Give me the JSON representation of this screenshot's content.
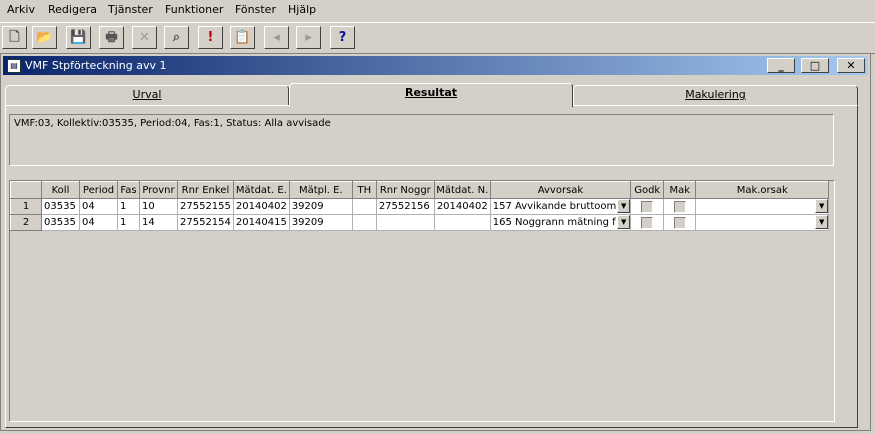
{
  "menu": [
    "Arkiv",
    "Redigera",
    "Tjänster",
    "Funktioner",
    "Fönster",
    "Hjälp"
  ],
  "toolbar": [
    {
      "icon": "new-document-icon",
      "glyph": "🗋"
    },
    {
      "icon": "open-folder-icon",
      "glyph": "📂"
    },
    {
      "icon": "save-icon",
      "glyph": "💾"
    },
    {
      "icon": "print-icon",
      "glyph": "🖶"
    },
    {
      "icon": "delete-x-icon",
      "glyph": "✕"
    },
    {
      "icon": "find-binoculars-icon",
      "glyph": "⌕"
    },
    {
      "icon": "alert-exclamation-icon",
      "glyph": "!"
    },
    {
      "icon": "clipboard-icon",
      "glyph": "📋"
    },
    {
      "icon": "previous-arrow-icon",
      "glyph": "◂"
    },
    {
      "icon": "next-arrow-icon",
      "glyph": "▸"
    },
    {
      "icon": "help-question-icon",
      "glyph": "?"
    }
  ],
  "window": {
    "title": "VMF Stpförteckning avv 1",
    "minimize": "_",
    "maximize": "□",
    "close": "✕"
  },
  "tabs": [
    {
      "label": "Urval",
      "active": false
    },
    {
      "label": "Resultat",
      "active": true
    },
    {
      "label": "Makulering",
      "active": false
    }
  ],
  "info_text": "VMF:03, Kollektiv:03535, Period:04, Fas:1, Status: Alla avvisade",
  "table": {
    "headers": [
      "",
      "Koll",
      "Period",
      "Fas",
      "Provnr",
      "Rnr Enkel",
      "Mätdat. E.",
      "Mätpl. E.",
      "TH",
      "Rnr Noggr",
      "Mätdat. N.",
      "Avvorsak",
      "Godk",
      "Mak",
      "Mak.orsak"
    ],
    "rows": [
      {
        "n": "1",
        "koll": "03535",
        "period": "04",
        "fas": "1",
        "provnr": "10",
        "rnr_enkel": "27552155",
        "matdat_e": "20140402",
        "matpl_e": "39209",
        "th": "",
        "rnr_noggr": "27552156",
        "matdat_n": "20140402",
        "avvorsak": "157 Avvikande bruttoom",
        "makorsak": ""
      },
      {
        "n": "2",
        "koll": "03535",
        "period": "04",
        "fas": "1",
        "provnr": "14",
        "rnr_enkel": "27552154",
        "matdat_e": "20140415",
        "matpl_e": "39209",
        "th": "",
        "rnr_noggr": "",
        "matdat_n": "",
        "avvorsak": "165 Noggrann mätning f",
        "makorsak": ""
      }
    ]
  }
}
